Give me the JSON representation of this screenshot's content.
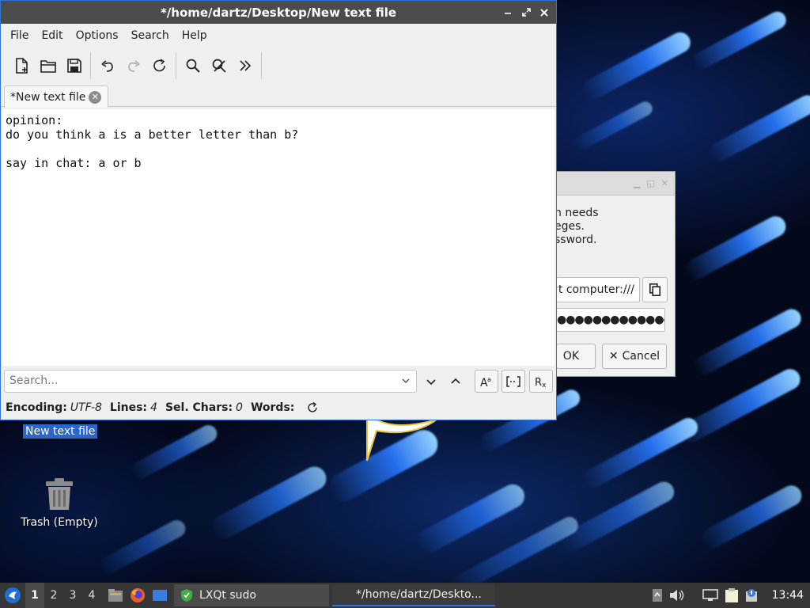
{
  "editor": {
    "title": "*/home/dartz/Desktop/New text file",
    "menu": [
      "File",
      "Edit",
      "Options",
      "Search",
      "Help"
    ],
    "tab_label": "*New text file",
    "text": "opinion:\ndo you think a is a better letter than b?\n\nsay in chat: a or b",
    "search_placeholder": "Search...",
    "status": {
      "encoding_label": "Encoding:",
      "encoding_value": "UTF-8",
      "lines_label": "Lines:",
      "lines_value": "4",
      "sel_label": "Sel. Chars:",
      "sel_value": "0",
      "words_label": "Words:"
    }
  },
  "sudo_dialog": {
    "message_lines": [
      "n needs",
      "eges.",
      "ssword."
    ],
    "command": "t computer:///",
    "password_mask": "●●●●●●●●●●●●●",
    "ok_label": "OK",
    "cancel_label": "Cancel"
  },
  "desktop": {
    "file_label": "New text file",
    "trash_label": "Trash (Empty)"
  },
  "taskbar": {
    "workspaces": [
      "1",
      "2",
      "3",
      "4"
    ],
    "sudo_task": "LXQt sudo",
    "editor_task": "*/home/dartz/Deskto...",
    "clock": "13:44"
  },
  "colors": {
    "accent": "#2f74d0",
    "titlebar": "#4b4b4b",
    "taskbar": "#363636"
  }
}
